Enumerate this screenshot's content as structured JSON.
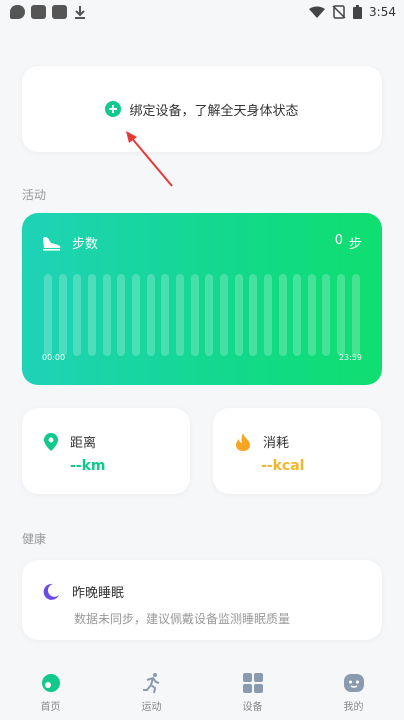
{
  "status": {
    "time": "3:54"
  },
  "bind_prompt": {
    "text": "绑定设备，了解全天身体状态"
  },
  "sections": {
    "activity_label": "活动",
    "health_label": "健康"
  },
  "steps_card": {
    "title": "步数",
    "value": "0",
    "unit": "步",
    "time_start": "00:00",
    "time_end": "23:59",
    "bar_count": 22
  },
  "distance_card": {
    "title": "距离",
    "value": "--km"
  },
  "calories_card": {
    "title": "消耗",
    "value": "--kcal"
  },
  "sleep_card": {
    "title": "昨晚睡眠",
    "subtitle": "数据未同步，建议佩戴设备监测睡眠质量"
  },
  "nav": {
    "items": [
      {
        "label": "首页",
        "icon": "home-icon",
        "active": true
      },
      {
        "label": "运动",
        "icon": "run-icon",
        "active": false
      },
      {
        "label": "设备",
        "icon": "device-grid-icon",
        "active": false
      },
      {
        "label": "我的",
        "icon": "profile-icon",
        "active": false
      }
    ]
  },
  "colors": {
    "accent": "#10c98a",
    "distance_value": "#10c98a",
    "calorie_value": "#f5b52a",
    "sleep_icon": "#6b4de6",
    "arrow": "#e53935"
  }
}
